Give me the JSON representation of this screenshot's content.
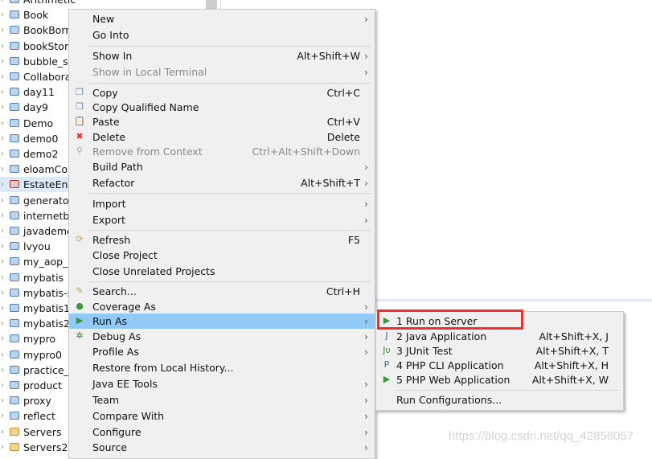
{
  "tree": {
    "items": [
      {
        "label": "Arithmetic",
        "icon": "folder-icon"
      },
      {
        "label": "Book",
        "icon": "folder-icon"
      },
      {
        "label": "BookBorr",
        "icon": "folder-icon"
      },
      {
        "label": "bookStor",
        "icon": "folder-icon"
      },
      {
        "label": "bubble_s",
        "icon": "folder-icon"
      },
      {
        "label": "Collabora",
        "icon": "folder-icon"
      },
      {
        "label": "day11",
        "icon": "folder-icon"
      },
      {
        "label": "day9",
        "icon": "folder-icon"
      },
      {
        "label": "Demo",
        "icon": "folder-icon"
      },
      {
        "label": "demo0",
        "icon": "folder-icon"
      },
      {
        "label": "demo2",
        "icon": "folder-icon"
      },
      {
        "label": "eloamCo",
        "icon": "folder-icon"
      },
      {
        "label": "EstateEng",
        "icon": "project-error-icon",
        "selected": true
      },
      {
        "label": "generato",
        "icon": "folder-icon"
      },
      {
        "label": "internetb",
        "icon": "folder-icon"
      },
      {
        "label": "javademo",
        "icon": "folder-icon"
      },
      {
        "label": "lvyou",
        "icon": "folder-icon"
      },
      {
        "label": "my_aop_",
        "icon": "folder-icon"
      },
      {
        "label": "mybatis",
        "icon": "folder-icon"
      },
      {
        "label": "mybatis-s",
        "icon": "folder-icon"
      },
      {
        "label": "mybatis1",
        "icon": "folder-icon"
      },
      {
        "label": "mybatis2",
        "icon": "folder-icon"
      },
      {
        "label": "mypro",
        "icon": "folder-icon"
      },
      {
        "label": "mypro0",
        "icon": "folder-icon"
      },
      {
        "label": "practice_",
        "icon": "folder-icon"
      },
      {
        "label": "product",
        "icon": "folder-icon"
      },
      {
        "label": "proxy",
        "icon": "folder-icon"
      },
      {
        "label": "reflect",
        "icon": "folder-icon"
      },
      {
        "label": "Servers",
        "icon": "open-folder-icon"
      },
      {
        "label": "Servers2",
        "icon": "open-folder-icon"
      }
    ]
  },
  "menu": {
    "items": [
      {
        "label": "New",
        "shortcut": "",
        "submenu": true
      },
      {
        "label": "Go Into",
        "shortcut": ""
      },
      {
        "sep": true
      },
      {
        "label": "Show In",
        "shortcut": "Alt+Shift+W",
        "submenu": true
      },
      {
        "label": "Show in Local Terminal",
        "shortcut": "",
        "submenu": true,
        "disabled": true
      },
      {
        "sep": true
      },
      {
        "label": "Copy",
        "shortcut": "Ctrl+C",
        "icon": "copy-icon"
      },
      {
        "label": "Copy Qualified Name",
        "shortcut": "",
        "icon": "copy-qualified-icon"
      },
      {
        "label": "Paste",
        "shortcut": "Ctrl+V",
        "icon": "paste-icon"
      },
      {
        "label": "Delete",
        "shortcut": "Delete",
        "icon": "delete-icon"
      },
      {
        "label": "Remove from Context",
        "shortcut": "Ctrl+Alt+Shift+Down",
        "disabled": true,
        "icon": "remove-context-icon"
      },
      {
        "label": "Build Path",
        "shortcut": "",
        "submenu": true
      },
      {
        "label": "Refactor",
        "shortcut": "Alt+Shift+T",
        "submenu": true
      },
      {
        "sep": true
      },
      {
        "label": "Import",
        "shortcut": "",
        "submenu": true
      },
      {
        "label": "Export",
        "shortcut": "",
        "submenu": true
      },
      {
        "sep": true
      },
      {
        "label": "Refresh",
        "shortcut": "F5",
        "icon": "refresh-icon"
      },
      {
        "label": "Close Project",
        "shortcut": ""
      },
      {
        "label": "Close Unrelated Projects",
        "shortcut": ""
      },
      {
        "sep": true
      },
      {
        "label": "Search...",
        "shortcut": "Ctrl+H",
        "icon": "search-icon"
      },
      {
        "label": "Coverage As",
        "shortcut": "",
        "submenu": true,
        "icon": "coverage-icon"
      },
      {
        "label": "Run As",
        "shortcut": "",
        "submenu": true,
        "icon": "run-icon",
        "highlighted": true
      },
      {
        "label": "Debug As",
        "shortcut": "",
        "submenu": true,
        "icon": "debug-icon"
      },
      {
        "label": "Profile As",
        "shortcut": "",
        "submenu": true
      },
      {
        "label": "Restore from Local History...",
        "shortcut": ""
      },
      {
        "label": "Java EE Tools",
        "shortcut": "",
        "submenu": true
      },
      {
        "label": "Team",
        "shortcut": "",
        "submenu": true
      },
      {
        "label": "Compare With",
        "shortcut": "",
        "submenu": true
      },
      {
        "label": "Configure",
        "shortcut": "",
        "submenu": true
      },
      {
        "label": "Source",
        "shortcut": "",
        "submenu": true
      }
    ]
  },
  "submenu": {
    "items": [
      {
        "label": "1 Run on Server",
        "shortcut": "",
        "icon": "server-run-icon"
      },
      {
        "label": "2 Java Application",
        "shortcut": "Alt+Shift+X, J",
        "icon": "java-app-icon"
      },
      {
        "label": "3 JUnit Test",
        "shortcut": "Alt+Shift+X, T",
        "icon": "junit-icon"
      },
      {
        "label": "4 PHP CLI Application",
        "shortcut": "Alt+Shift+X, H",
        "icon": "php-cli-icon"
      },
      {
        "label": "5 PHP Web Application",
        "shortcut": "Alt+Shift+X, W",
        "icon": "php-web-icon"
      },
      {
        "sep": true
      },
      {
        "label": "Run Configurations...",
        "shortcut": ""
      }
    ]
  },
  "highlight_color": "#91c9f7",
  "annotation_color": "#f03030",
  "watermark": "https://blog.csdn.net/qq_42858057"
}
